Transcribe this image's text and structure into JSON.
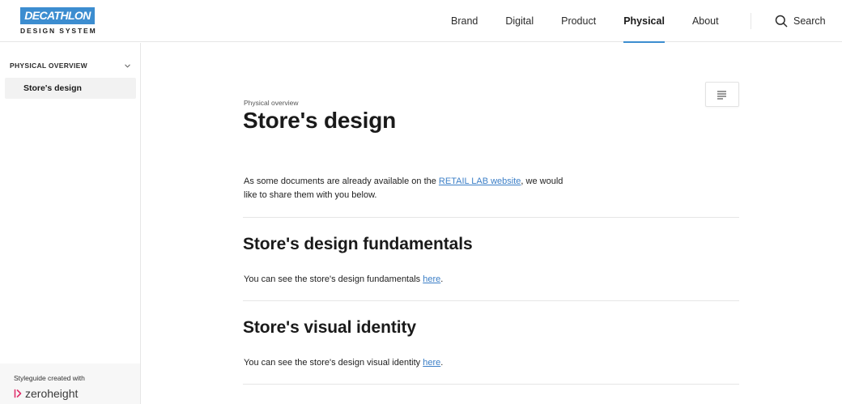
{
  "brand": {
    "logo_text": "DECATHLON",
    "logo_subtitle": "DESIGN SYSTEM",
    "logo_color": "#3c8dd0"
  },
  "nav": {
    "items": [
      {
        "label": "Brand",
        "active": false
      },
      {
        "label": "Digital",
        "active": false
      },
      {
        "label": "Product",
        "active": false
      },
      {
        "label": "Physical",
        "active": true
      },
      {
        "label": "About",
        "active": false
      }
    ],
    "search_label": "Search",
    "accent_color": "#3c8dd0"
  },
  "sidebar": {
    "section_label": "PHYSICAL OVERVIEW",
    "items": [
      {
        "label": "Store's design",
        "active": true
      }
    ],
    "footer_created": "Styleguide created with",
    "footer_brand": "zeroheight"
  },
  "main": {
    "eyebrow": "Physical overview",
    "title": "Store's design",
    "intro_before": "As some documents are already available on the ",
    "intro_link": "RETAIL LAB website",
    "intro_after": ", we would like to share them with you below.",
    "sections": [
      {
        "heading": "Store's design fundamentals",
        "text_before": "You can see the store's design fundamentals ",
        "link": "here",
        "text_after": "."
      },
      {
        "heading": "Store's visual identity",
        "text_before": "You can see the store's design visual identity ",
        "link": "here",
        "text_after": "."
      }
    ]
  },
  "icons": {
    "search": "search-icon",
    "chevron": "chevron-down-icon",
    "toc": "table-of-contents-icon",
    "zeroheight": "zeroheight-logo-icon"
  }
}
